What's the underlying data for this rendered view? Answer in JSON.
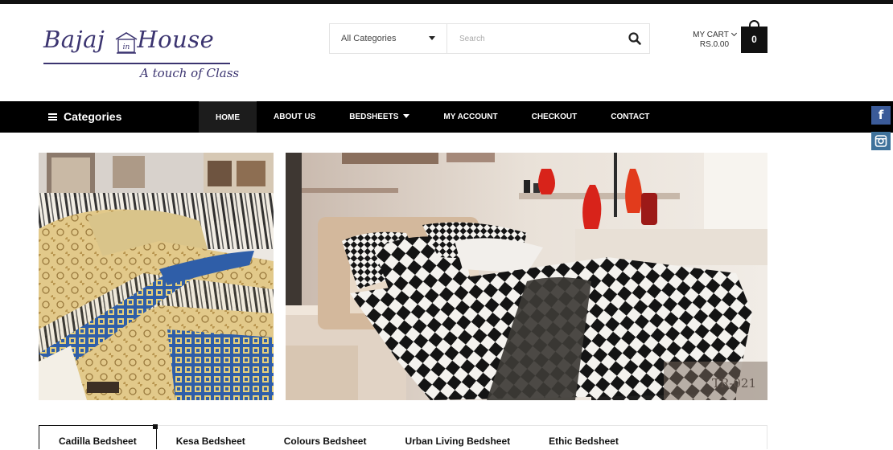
{
  "brand": {
    "name": "Bajaj House",
    "name_left": "Bajaj",
    "name_right": "House",
    "tagline": "A touch of Class",
    "color": "#3b3470"
  },
  "search": {
    "category_selected": "All Categories",
    "placeholder": "Search",
    "icon": "search-icon"
  },
  "cart": {
    "label": "MY CART",
    "total": "RS.0.00",
    "count": "0",
    "icon": "shopping-bag-icon"
  },
  "nav": {
    "categories_label": "Categories",
    "items": [
      {
        "label": "HOME",
        "active": true
      },
      {
        "label": "ABOUT US"
      },
      {
        "label": "BEDSHEETS",
        "has_dropdown": true
      },
      {
        "label": "MY ACCOUNT"
      },
      {
        "label": "CHECKOUT"
      },
      {
        "label": "CONTACT"
      }
    ],
    "background": "#000000"
  },
  "social": {
    "facebook_glyph": "f",
    "facebook_color": "#3b5b99",
    "instagram_color": "#3f729b"
  },
  "banners": {
    "left": {
      "alt": "Bedsheet with gold and blue pattern"
    },
    "right": {
      "alt": "Bedsheet with black and white checkered pattern",
      "code": "TR-021"
    }
  },
  "tabs": [
    {
      "label": "Cadilla Bedsheet",
      "active": true
    },
    {
      "label": "Kesa Bedsheet"
    },
    {
      "label": "Colours Bedsheet"
    },
    {
      "label": "Urban Living Bedsheet"
    },
    {
      "label": "Ethic Bedsheet"
    }
  ]
}
